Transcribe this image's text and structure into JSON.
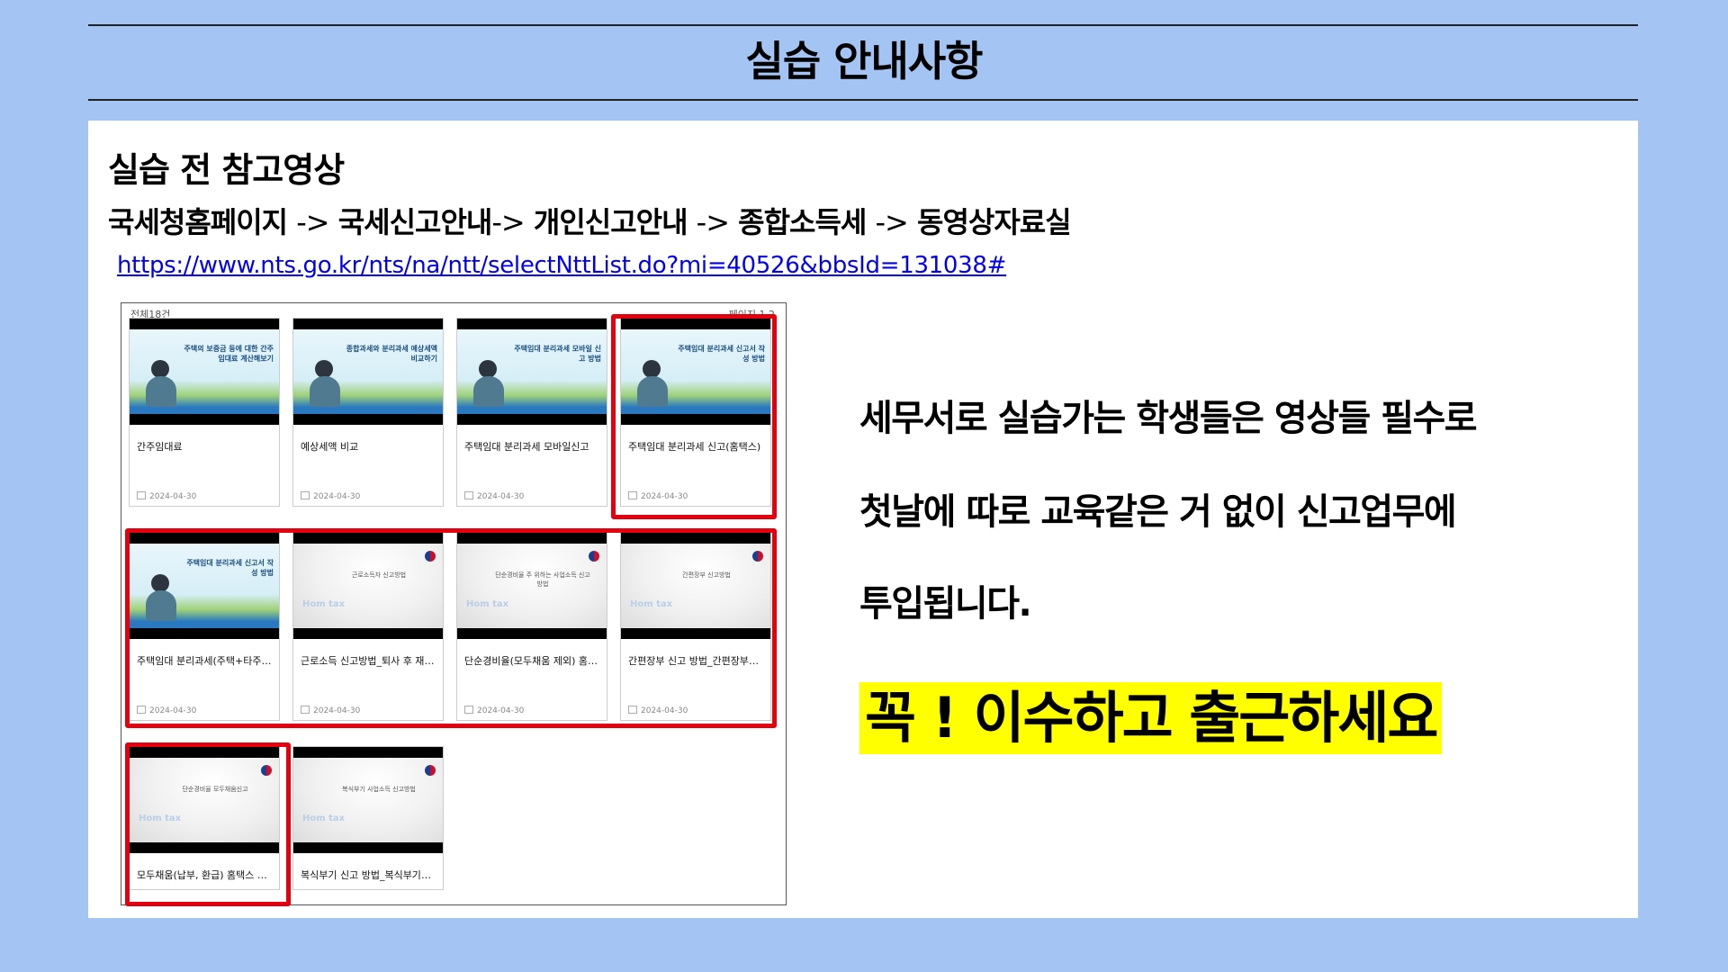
{
  "header": {
    "title": "실습 안내사항"
  },
  "section": {
    "title": "실습 전 참고영상",
    "path": [
      "국세청홈페이지",
      "국세신고안내",
      "개인신고안내",
      "종합소득세",
      "동영상자료실"
    ],
    "path_sep": "->",
    "link": "https://www.nts.go.kr/nts/na/ntt/selectNttList.do?mi=40526&bbsId=131038#"
  },
  "board": {
    "count_label": "전체18건",
    "pager_label": "페이지 1 2",
    "cards": [
      {
        "label": "간주임대료",
        "date": "2024-04-30",
        "thumb_text": "주택의 보증금 등에 대한 간주임대료 계산해보기",
        "style": "illustration"
      },
      {
        "label": "예상세액 비교",
        "date": "2024-04-30",
        "thumb_text": "종합과세와 분리과세 예상세액 비교하기",
        "style": "illustration"
      },
      {
        "label": "주택임대 분리과세 모바일신고",
        "date": "2024-04-30",
        "thumb_text": "주택임대 분리과세 모바일 신고 방법",
        "style": "illustration"
      },
      {
        "label": "주택임대 분리과세 신고(홈택스)",
        "date": "2024-04-30",
        "thumb_text": "주택임대 분리과세 신고서 작성 방법",
        "style": "illustration"
      },
      {
        "label": "주택임대 분리과세(주택+타주택)",
        "date": "2024-04-30",
        "thumb_text": "주택임대 분리과세 신고서 작성 방법",
        "style": "illustration"
      },
      {
        "label": "근로소득 신고방법_퇴사 후 재취...",
        "date": "2024-04-30",
        "thumb_text": "근로소득자 신고방법",
        "style": "hometax"
      },
      {
        "label": "단순경비율(모두채움 제외) 홈택...",
        "date": "2024-04-30",
        "thumb_text": "단순경비율 주 위하는 사업소득 신고방법",
        "style": "hometax"
      },
      {
        "label": "간편장부 신고 방법_간편장부대...",
        "date": "2024-04-30",
        "thumb_text": "간편장부 신고방법",
        "style": "hometax"
      },
      {
        "label": "모두채움(납부, 환급) 홈택스 신...",
        "date": "",
        "thumb_text": "단순경비율 모두채움신고",
        "style": "hometax"
      },
      {
        "label": "복식부기 신고 방법_복식부기의...",
        "date": "",
        "thumb_text": "복식부기 사업소득 신고방법",
        "style": "hometax"
      }
    ],
    "hometax_mark": "Hom tax"
  },
  "notice": {
    "lines": [
      "세무서로 실습가는 학생들은 영상들 필수로",
      "첫날에 따로 교육같은 거 없이 신고업무에",
      "투입됩니다."
    ],
    "highlight": "꼭 ! 이수하고 출근하세요",
    "highlight_color": "#ffff00"
  },
  "colors": {
    "background": "#a4c4f4",
    "panel": "#ffffff",
    "red_box": "#e3000f",
    "link": "#0000ee"
  }
}
